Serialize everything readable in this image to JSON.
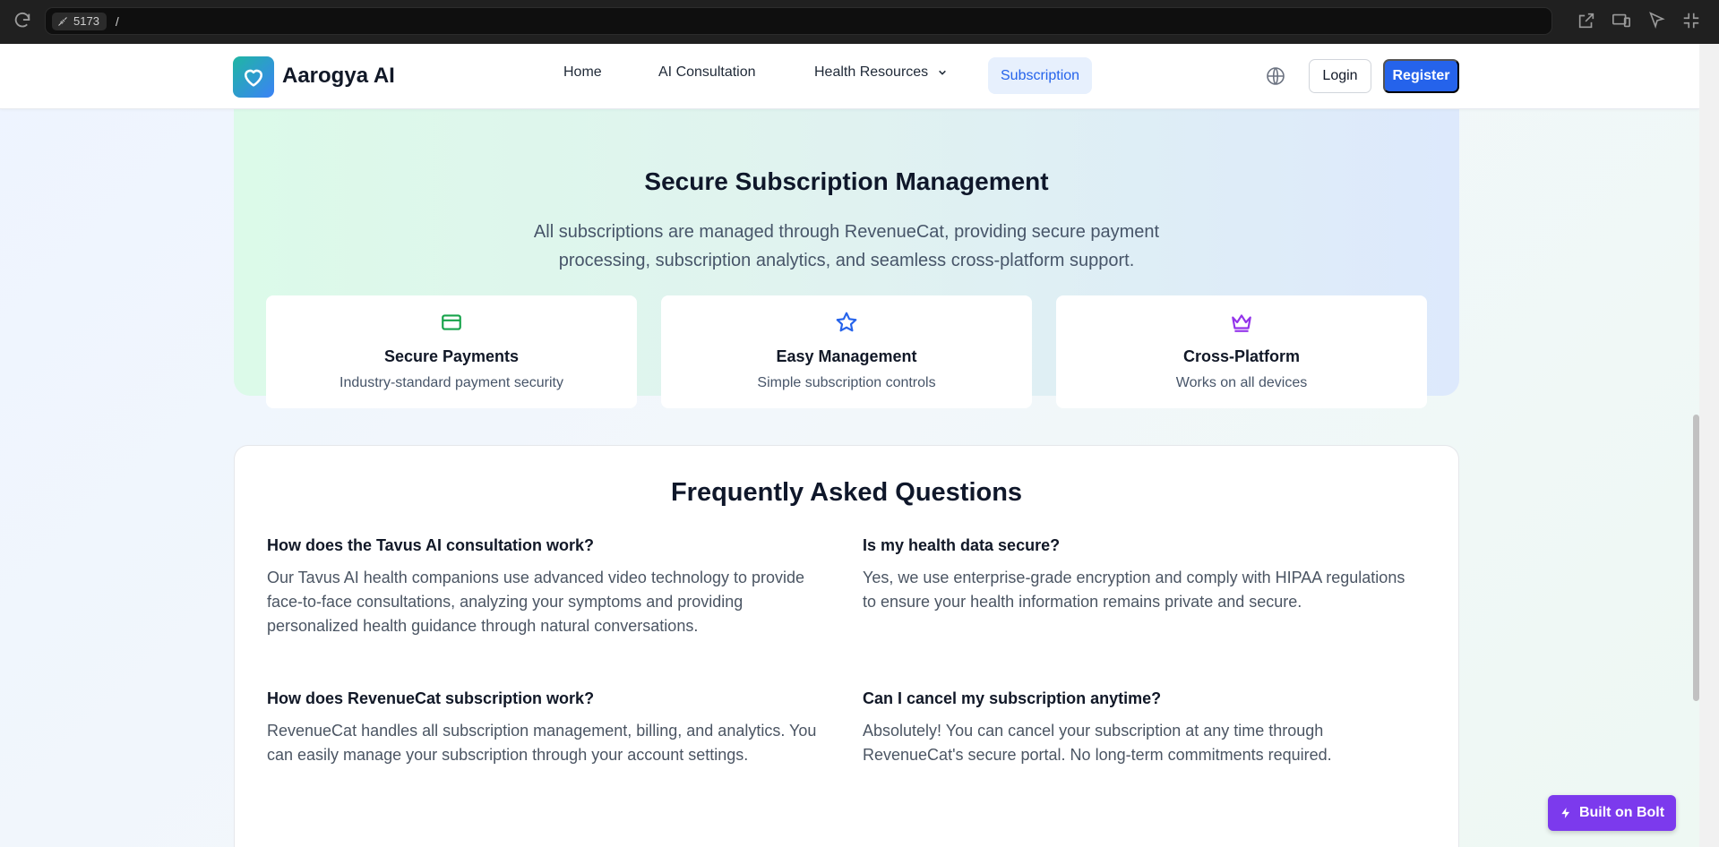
{
  "browser": {
    "port": "5173",
    "path": "/"
  },
  "nav": {
    "brand": "Aarogya AI",
    "links": [
      "Home",
      "AI Consultation",
      "Health Resources",
      "Subscription"
    ],
    "login": "Login",
    "register": "Register",
    "accent_color": "#2563eb"
  },
  "secure": {
    "title": "Secure Subscription Management",
    "description": "All subscriptions are managed through RevenueCat, providing secure payment processing, subscription analytics, and seamless cross-platform support.",
    "features": [
      {
        "icon": "credit-card-icon",
        "title": "Secure Payments",
        "desc": "Industry-standard payment security",
        "color": "#16a34a"
      },
      {
        "icon": "star-icon",
        "title": "Easy Management",
        "desc": "Simple subscription controls",
        "color": "#2563eb"
      },
      {
        "icon": "crown-icon",
        "title": "Cross-Platform",
        "desc": "Works on all devices",
        "color": "#9333ea"
      }
    ]
  },
  "faq": {
    "title": "Frequently Asked Questions",
    "items": [
      {
        "q": "How does the Tavus AI consultation work?",
        "a": "Our Tavus AI health companions use advanced video technology to provide face-to-face consultations, analyzing your symptoms and providing personalized health guidance through natural conversations."
      },
      {
        "q": "Is my health data secure?",
        "a": "Yes, we use enterprise-grade encryption and comply with HIPAA regulations to ensure your health information remains private and secure."
      },
      {
        "q": "How does RevenueCat subscription work?",
        "a": "RevenueCat handles all subscription management, billing, and analytics. You can easily manage your subscription through your account settings."
      },
      {
        "q": "Can I cancel my subscription anytime?",
        "a": "Absolutely! You can cancel your subscription at any time through RevenueCat's secure portal. No long-term commitments required."
      }
    ]
  },
  "bolt": {
    "label": "Built on Bolt"
  }
}
